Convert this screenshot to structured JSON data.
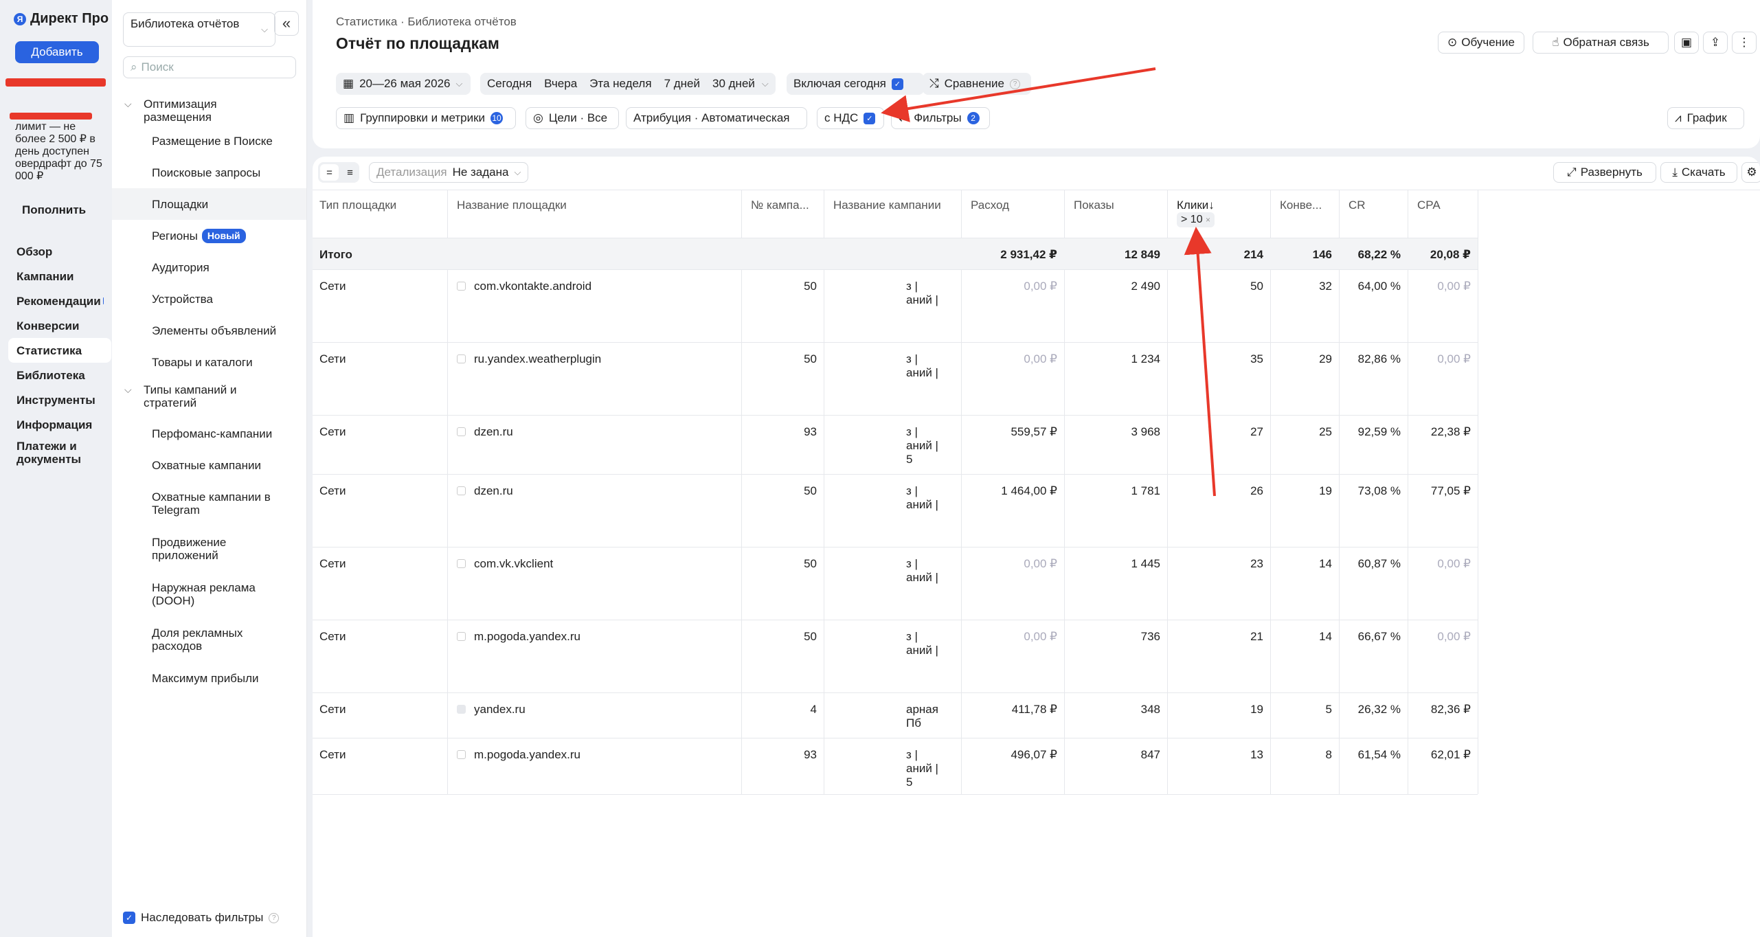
{
  "nav": {
    "brand": "Директ Про",
    "add_label": "Добавить",
    "limit_text": "лимит — не более 2 500 ₽ в день доступен овердрафт до 75 000 ₽",
    "topup_label": "Пополнить",
    "items": [
      "Обзор",
      "Кампании",
      "Рекомендации",
      "Конверсии",
      "Статистика",
      "Библиотека",
      "Инструменты",
      "Информация",
      "Платежи и документы"
    ],
    "active": "Статистика"
  },
  "library": {
    "selector": "Библиотека отчётов",
    "search_placeholder": "Поиск",
    "group1": "Оптимизация размещения",
    "group1_items": [
      "Размещение в Поиске",
      "Поисковые запросы",
      "Площадки",
      "Регионы",
      "Аудитория",
      "Устройства",
      "Элементы объявлений",
      "Товары и каталоги"
    ],
    "new_badge": "Новый",
    "group2": "Типы кампаний и стратегий",
    "group2_items": [
      "Перфоманс-кампании",
      "Охватные кампании",
      "Охватные кампании в Telegram",
      "Продвижение приложений",
      "Наружная реклама (DOOH)",
      "Доля рекламных расходов",
      "Максимум прибыли"
    ],
    "inherit_label": "Наследовать фильтры"
  },
  "header": {
    "breadcrumb": [
      "Статистика",
      "Библиотека отчётов"
    ],
    "title": "Отчёт по площадкам",
    "learn": "Обучение",
    "feedback": "Обратная связь",
    "date_range": "20—26 мая 2026",
    "presets": [
      "Сегодня",
      "Вчера",
      "Эта неделя",
      "7 дней",
      "30 дней"
    ],
    "include_today": "Включая сегодня",
    "compare": "Сравнение",
    "groupings": "Группировки и метрики",
    "groupings_count": "10",
    "goals": "Цели · Все",
    "attribution": "Атрибуция · Автоматическая",
    "vat": "с НДС",
    "filters": "Фильтры",
    "filters_count": "2",
    "chart": "График"
  },
  "table": {
    "detail_label": "Детализация",
    "detail_value": "Не задана",
    "expand": "Развернуть",
    "download": "Скачать",
    "columns": [
      "Тип площадки",
      "Название площадки",
      "№ кампа...",
      "Название кампании",
      "Расход",
      "Показы",
      "Клики↓",
      "Конве...",
      "CR",
      "CPA"
    ],
    "clicks_filter": "> 10",
    "total": {
      "label": "Итого",
      "spend": "2 931,42 ₽",
      "impressions": "12 849",
      "clicks": "214",
      "conv": "146",
      "cr": "68,22 %",
      "cpa": "20,08 ₽"
    },
    "rows": [
      {
        "type": "Сети",
        "site": "com.vkontakte.android",
        "camp_id": "50",
        "camp_name": [
          "з |",
          "аний |"
        ],
        "spend": "0,00 ₽",
        "impressions": "2 490",
        "clicks": "50",
        "conv": "32",
        "cr": "64,00 %",
        "cpa": "0,00 ₽"
      },
      {
        "type": "Сети",
        "site": "ru.yandex.weatherplugin",
        "camp_id": "50",
        "camp_name": [
          "з |",
          "аний |"
        ],
        "spend": "0,00 ₽",
        "impressions": "1 234",
        "clicks": "35",
        "conv": "29",
        "cr": "82,86 %",
        "cpa": "0,00 ₽"
      },
      {
        "type": "Сети",
        "site": "dzen.ru",
        "camp_id": "93",
        "camp_name": [
          "з |",
          "аний |",
          "5"
        ],
        "spend": "559,57 ₽",
        "impressions": "3 968",
        "clicks": "27",
        "conv": "25",
        "cr": "92,59 %",
        "cpa": "22,38 ₽"
      },
      {
        "type": "Сети",
        "site": "dzen.ru",
        "camp_id": "50",
        "camp_name": [
          "з |",
          "аний |"
        ],
        "spend": "1 464,00 ₽",
        "impressions": "1 781",
        "clicks": "26",
        "conv": "19",
        "cr": "73,08 %",
        "cpa": "77,05 ₽"
      },
      {
        "type": "Сети",
        "site": "com.vk.vkclient",
        "camp_id": "50",
        "camp_name": [
          "з |",
          "аний |"
        ],
        "spend": "0,00 ₽",
        "impressions": "1 445",
        "clicks": "23",
        "conv": "14",
        "cr": "60,87 %",
        "cpa": "0,00 ₽"
      },
      {
        "type": "Сети",
        "site": "m.pogoda.yandex.ru",
        "camp_id": "50",
        "camp_name": [
          "з |",
          "аний |"
        ],
        "spend": "0,00 ₽",
        "impressions": "736",
        "clicks": "21",
        "conv": "14",
        "cr": "66,67 %",
        "cpa": "0,00 ₽"
      },
      {
        "type": "Сети",
        "site": "yandex.ru",
        "camp_id": "4",
        "camp_name": [
          "арная",
          "Пб"
        ],
        "spend": "411,78 ₽",
        "impressions": "348",
        "clicks": "19",
        "conv": "5",
        "cr": "26,32 %",
        "cpa": "82,36 ₽"
      },
      {
        "type": "Сети",
        "site": "m.pogoda.yandex.ru",
        "camp_id": "93",
        "camp_name": [
          "з |",
          "аний |",
          "5"
        ],
        "spend": "496,07 ₽",
        "impressions": "847",
        "clicks": "13",
        "conv": "8",
        "cr": "61,54 %",
        "cpa": "62,01 ₽"
      }
    ]
  },
  "colors": {
    "accent": "#2a63e0",
    "annotation": "#e8382a"
  }
}
